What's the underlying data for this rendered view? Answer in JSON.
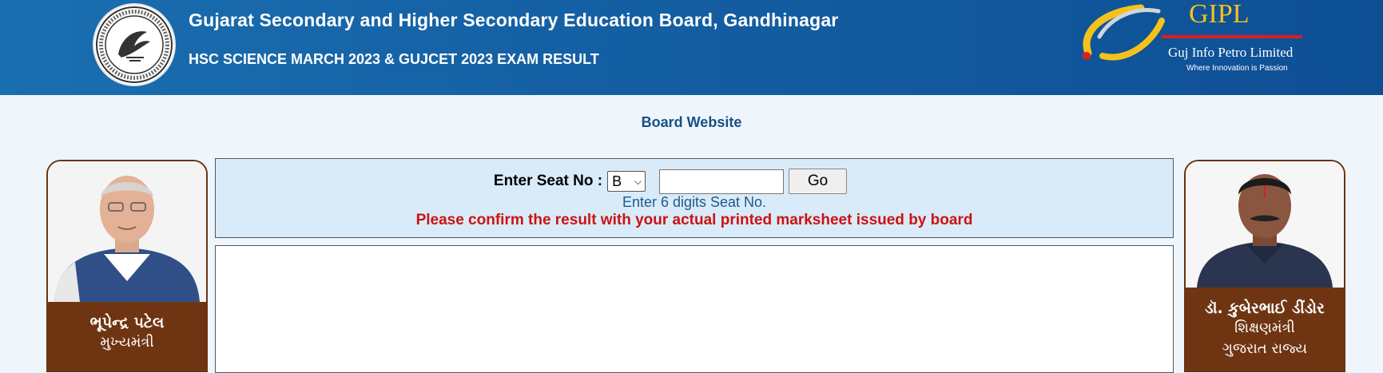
{
  "header": {
    "title": "Gujarat Secondary and Higher Secondary Education Board, Gandhinagar",
    "subtitle": "HSC SCIENCE MARCH 2023 & GUJCET 2023 EXAM RESULT",
    "logo_icon": "board-seal-icon",
    "partner_logo": {
      "brand": "GIPL",
      "name": "Guj Info Petro Limited",
      "tagline": "Where Innovation is Passion"
    },
    "colors": {
      "header_bg": "#1560a4",
      "header_text": "#ffffff"
    }
  },
  "board_link": {
    "label": "Board Website",
    "color": "#1a4f86"
  },
  "left_card": {
    "name": "ભૂપેન્દ્ર પટેલ",
    "designation": "મુખ્યમંત્રી",
    "photo_icon": "chief-minister-photo"
  },
  "right_card": {
    "name": "ડૉ. કુબેરભાઈ ડીંડોર",
    "designation": "શિક્ષણમંત્રી",
    "region": "ગુજરાત રાજ્ય",
    "photo_icon": "education-minister-photo"
  },
  "search": {
    "label": "Enter Seat No :",
    "series_selected": "B",
    "seat_value": "",
    "go_label": "Go",
    "hint": "Enter 6 digits Seat No.",
    "warning": "Please confirm the result with your actual printed marksheet issued by board",
    "colors": {
      "panel_bg": "#d9ebf9",
      "warning": "#cc1212",
      "hint": "#1d5a8c"
    }
  },
  "card_colors": {
    "name_panel_bg": "#6f3512",
    "border": "#6a3412"
  }
}
